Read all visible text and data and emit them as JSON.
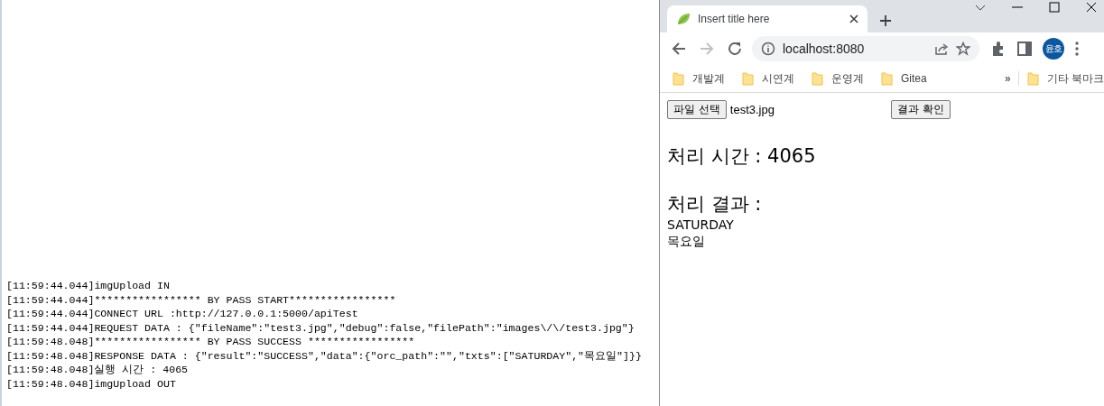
{
  "console": {
    "lines": [
      "[11:59:44.044]imgUpload IN",
      "[11:59:44.044]***************** BY PASS START*****************",
      "[11:59:44.044]CONNECT URL :http://127.0.0.1:5000/apiTest",
      "[11:59:44.044]REQUEST DATA : {\"fileName\":\"test3.jpg\",\"debug\":false,\"filePath\":\"images\\/\\/test3.jpg\"}",
      "[11:59:48.048]***************** BY PASS SUCCESS *****************",
      "[11:59:48.048]RESPONSE DATA : {\"result\":\"SUCCESS\",\"data\":{\"orc_path\":\"\",\"txts\":[\"SATURDAY\",\"목요일\"]}}",
      "[11:59:48.048]실행 시간 : 4065",
      "[11:59:48.048]imgUpload OUT"
    ]
  },
  "browser": {
    "tabs": [
      {
        "title": "Insert title here",
        "selected": true
      }
    ],
    "address": "localhost:8080",
    "profile": "윤호",
    "bookmarks": [
      {
        "label": "개발계"
      },
      {
        "label": "시연계"
      },
      {
        "label": "운영계"
      },
      {
        "label": "Gitea"
      }
    ],
    "more_bookmarks": "»",
    "other_bookmarks": "기타 북마크",
    "page": {
      "file_button": "파일 선택",
      "file_name": "test3.jpg",
      "check_button": "결과 확인",
      "time_heading": "처리 시간 : 4065",
      "result_heading": "처리 결과 :",
      "results": [
        "SATURDAY",
        "목요일"
      ]
    }
  }
}
